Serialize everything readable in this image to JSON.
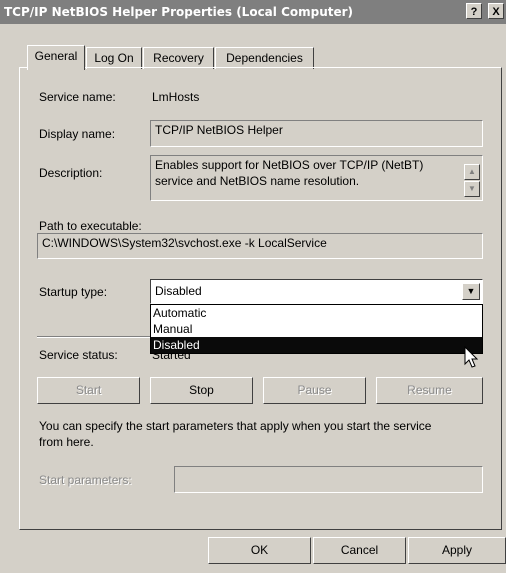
{
  "window": {
    "title": "TCP/IP NetBIOS Helper Properties (Local Computer)",
    "help_glyph": "?",
    "close_glyph": "X"
  },
  "tabs": [
    {
      "label": "General",
      "active": true
    },
    {
      "label": "Log On",
      "active": false
    },
    {
      "label": "Recovery",
      "active": false
    },
    {
      "label": "Dependencies",
      "active": false
    }
  ],
  "general": {
    "service_name_label": "Service name:",
    "service_name_value": "LmHosts",
    "display_name_label": "Display name:",
    "display_name_value": "TCP/IP NetBIOS Helper",
    "description_label": "Description:",
    "description_line1": "Enables support for NetBIOS over TCP/IP (NetBT)",
    "description_line2": "service and NetBIOS name resolution.",
    "path_label": "Path to executable:",
    "path_value": "C:\\WINDOWS\\System32\\svchost.exe -k LocalService",
    "startup_type_label": "Startup type:",
    "startup_type_value": "Disabled",
    "startup_options": [
      "Automatic",
      "Manual",
      "Disabled"
    ],
    "startup_selected_index": 2,
    "service_status_label": "Service status:",
    "service_status_value": "Started",
    "buttons": {
      "start": "Start",
      "stop": "Stop",
      "pause": "Pause",
      "resume": "Resume"
    },
    "help_text_line1": "You can specify the start parameters that apply when you start the service",
    "help_text_line2": "from here.",
    "start_params_label": "Start parameters:",
    "start_params_value": ""
  },
  "footer": {
    "ok": "OK",
    "cancel": "Cancel",
    "apply": "Apply"
  },
  "icons": {
    "scroll_up": "up-arrow-icon",
    "scroll_down": "down-arrow-icon",
    "dropdown": "chevron-down-icon",
    "cursor": "mouse-pointer-icon"
  }
}
